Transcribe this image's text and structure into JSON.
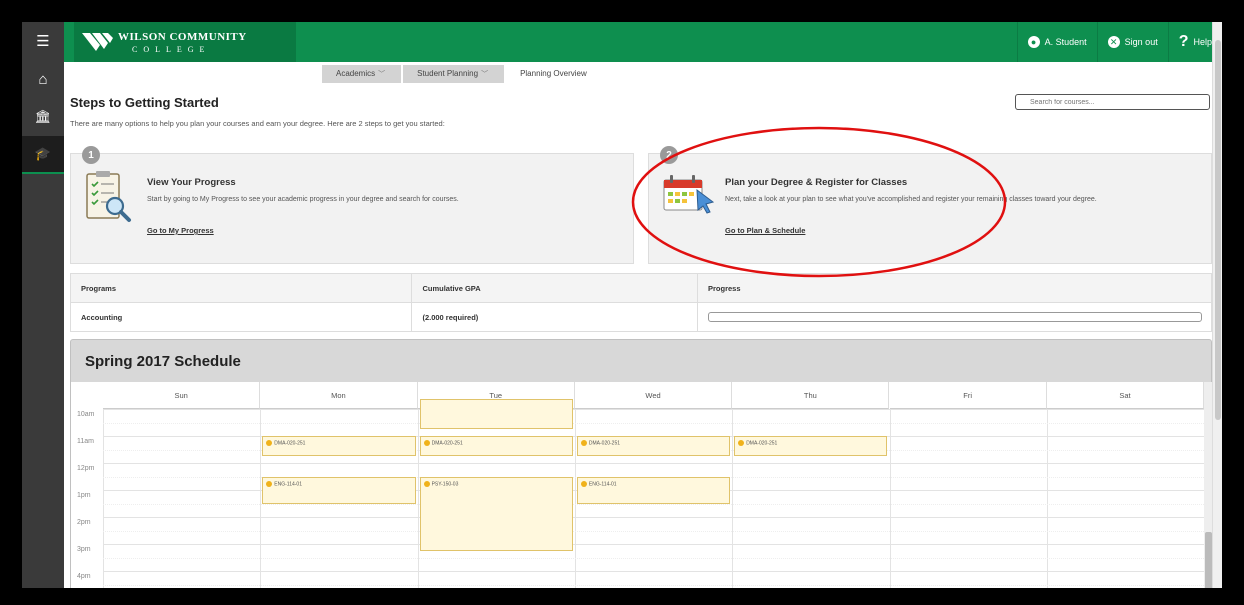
{
  "app": {
    "logo_line1": "WILSON COMMUNITY",
    "logo_line2": "COLLEGE",
    "user": "A. Student",
    "signout": "Sign out",
    "help": "Help",
    "help_glyph": "?"
  },
  "sidebar": {
    "items": [
      {
        "name": "menu-icon",
        "glyph": "☰"
      },
      {
        "name": "home-icon",
        "glyph": "⌂"
      },
      {
        "name": "institution-icon",
        "glyph": "🏛"
      },
      {
        "name": "graduation-cap-icon",
        "glyph": "🎓"
      }
    ]
  },
  "breadcrumb": {
    "items": [
      "Academics",
      "Student Planning",
      "Planning Overview"
    ]
  },
  "page": {
    "title": "Steps to Getting Started",
    "subtitle": "There are many options to help you plan your courses and earn your degree. Here are 2 steps to get you started:",
    "search_placeholder": "Search for courses..."
  },
  "steps": [
    {
      "num": "1",
      "title": "View Your Progress",
      "desc": "Start by going to My Progress to see your academic progress in your degree and search for courses.",
      "link": "Go to My Progress"
    },
    {
      "num": "2",
      "title": "Plan your Degree & Register for Classes",
      "desc": "Next, take a look at your plan to see what you've accomplished and register your remaining classes toward your degree.",
      "link": "Go to Plan & Schedule"
    }
  ],
  "programs_table": {
    "headers": [
      "Programs",
      "Cumulative GPA",
      "Progress"
    ],
    "rows": [
      {
        "program": "Accounting",
        "gpa": "(2.000 required)",
        "progress": 0
      }
    ]
  },
  "schedule": {
    "title": "Spring 2017 Schedule",
    "days": [
      "Sun",
      "Mon",
      "Tue",
      "Wed",
      "Thu",
      "Fri",
      "Sat"
    ],
    "times": [
      "10am",
      "11am",
      "12pm",
      "1pm",
      "2pm",
      "3pm",
      "4pm"
    ],
    "courses": [
      {
        "code": "",
        "day": 2,
        "start": 10.0,
        "end": 10.75
      },
      {
        "code": "DMA-020-251",
        "day": 1,
        "start": 11.0,
        "end": 11.75
      },
      {
        "code": "DMA-020-251",
        "day": 2,
        "start": 11.0,
        "end": 11.75
      },
      {
        "code": "DMA-020-251",
        "day": 3,
        "start": 11.0,
        "end": 11.75
      },
      {
        "code": "DMA-020-251",
        "day": 4,
        "start": 11.0,
        "end": 11.75
      },
      {
        "code": "ENG-114-01",
        "day": 1,
        "start": 12.5,
        "end": 13.5
      },
      {
        "code": "PSY-150-03",
        "day": 2,
        "start": 12.5,
        "end": 15.25
      },
      {
        "code": "ENG-114-01",
        "day": 3,
        "start": 12.5,
        "end": 13.5
      }
    ]
  },
  "colors": {
    "brand_green": "#0e8f4f",
    "annotation_red": "#e01010",
    "course_fill": "#fff8dd"
  }
}
